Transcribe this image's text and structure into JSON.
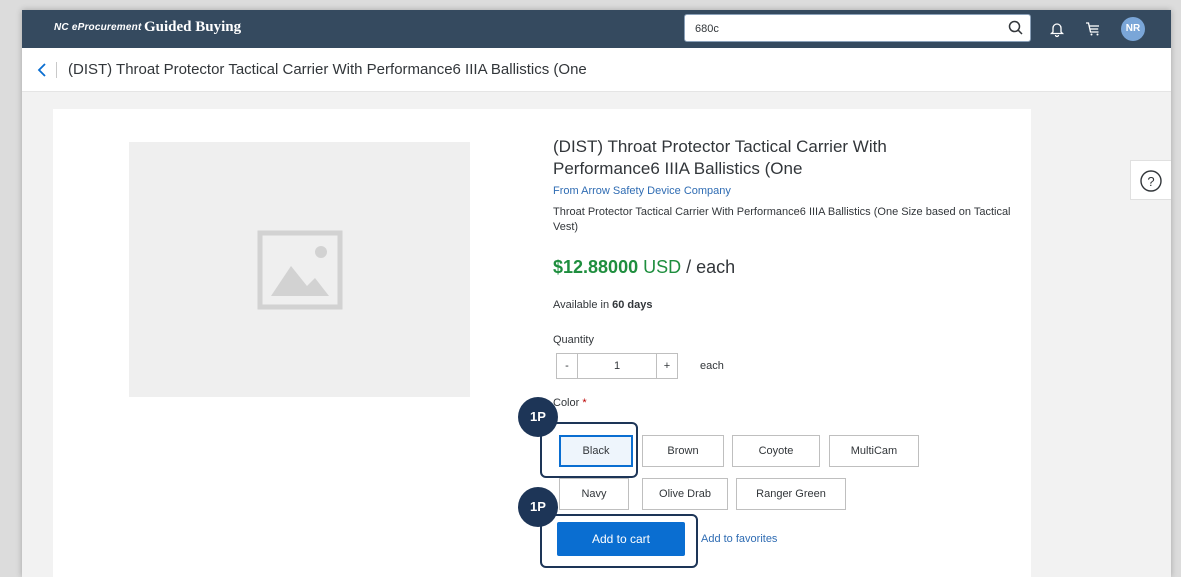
{
  "topbar": {
    "brand_small": "NC eProcurement",
    "brand_title": "Guided Buying",
    "search_value": "680c",
    "avatar_initials": "NR"
  },
  "header": {
    "title": "(DIST) Throat Protector Tactical Carrier With Performance6 IIIA Ballistics (One"
  },
  "product": {
    "title": "(DIST) Throat Protector Tactical Carrier With Performance6 IIIA Ballistics (One",
    "supplier": "From Arrow Safety Device Company",
    "description": "Throat Protector Tactical Carrier With Performance6 IIIA Ballistics (One Size based on Tactical Vest)",
    "price_amount": "$12.88000",
    "price_currency": "USD",
    "price_unit": " / each",
    "availability_prefix": "Available in ",
    "availability_days": "60 days",
    "quantity_label": "Quantity",
    "quantity_value": "1",
    "quantity_minus": "-",
    "quantity_plus": "+",
    "quantity_unit": "each",
    "color_label": "Color",
    "color_required": " *",
    "colors": [
      "Black",
      "Brown",
      "Coyote",
      "MultiCam",
      "Navy",
      "Olive Drab",
      "Ranger Green"
    ],
    "selected_color": "Black",
    "add_to_cart": "Add to cart",
    "add_to_favorites": "Add to favorites"
  },
  "callouts": {
    "color_badge": "1P",
    "cart_badge": "1P"
  },
  "colors_theme": {
    "topbar": "#354a5f",
    "price": "#1e8e3e",
    "link": "#2f6cb3",
    "primary_button": "#0a6ed1",
    "callout": "#1d3557"
  }
}
